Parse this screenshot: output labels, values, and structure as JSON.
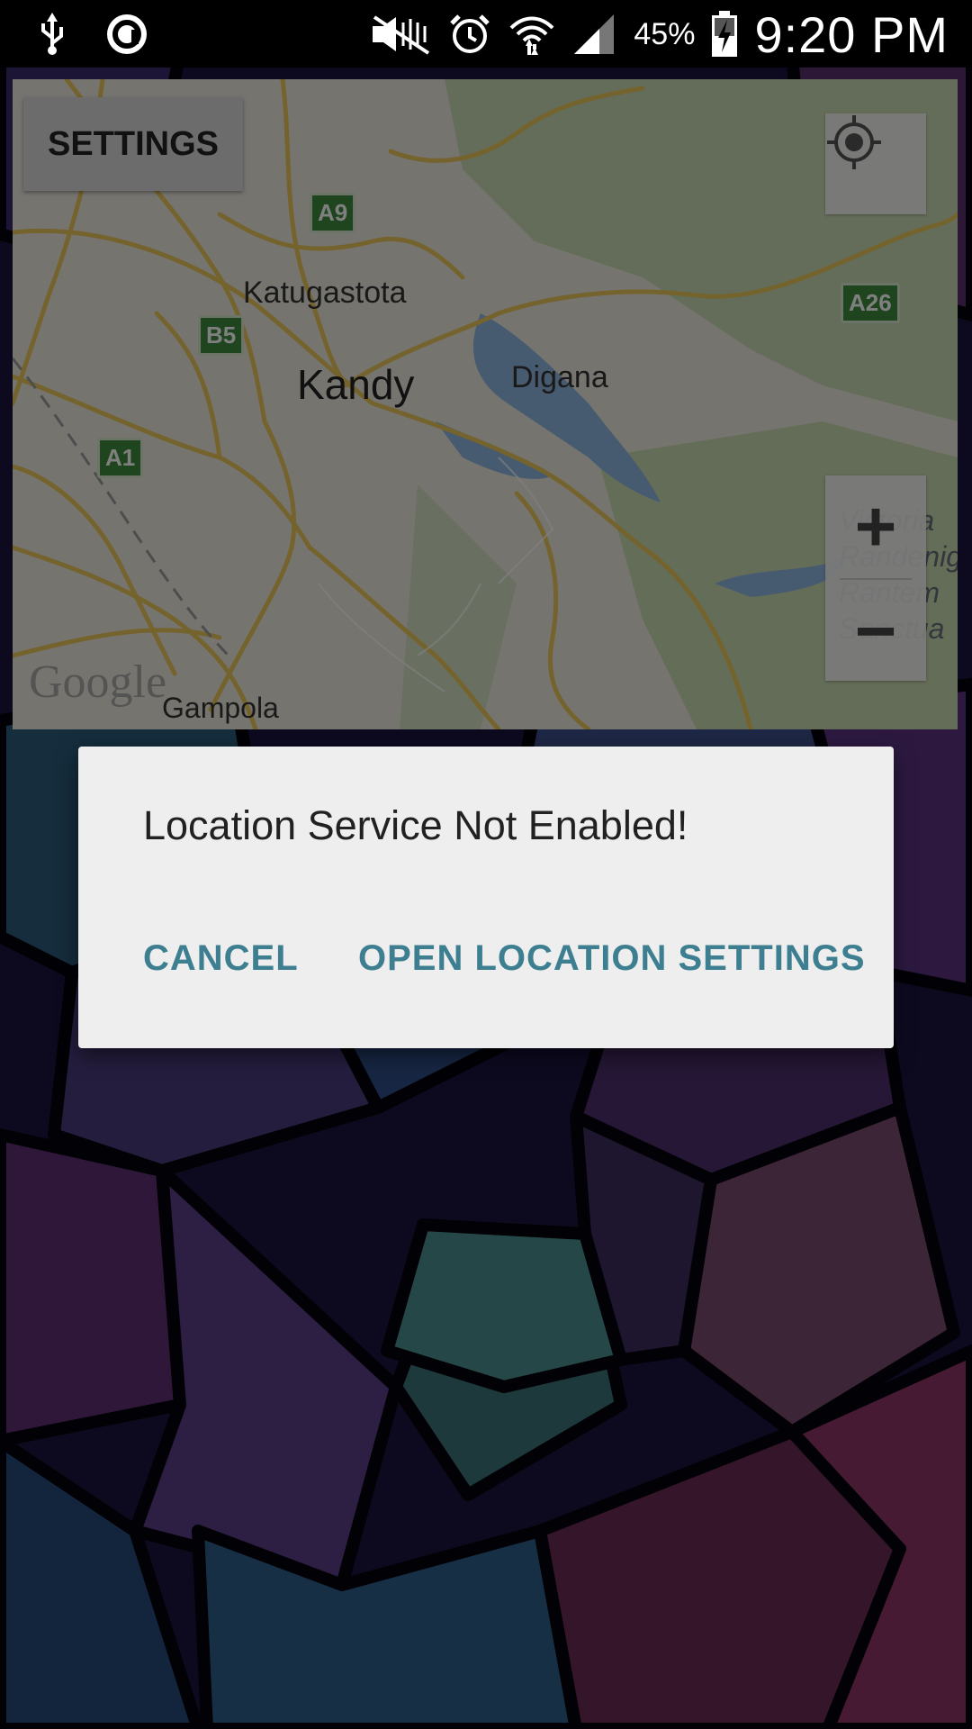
{
  "status_bar": {
    "battery_percent": "45%",
    "time": "9:20 PM",
    "icons": [
      "usb-icon",
      "app-notification-icon",
      "mute-icon",
      "alarm-icon",
      "wifi-icon",
      "signal-icon",
      "battery-charging-icon"
    ]
  },
  "map": {
    "settings_button_label": "SETTINGS",
    "places": {
      "katugastota": "Katugastota",
      "kandy": "Kandy",
      "digana": "Digana",
      "gampola": "Gampola",
      "victoria_partial": "Victoria\nRandenig\nRantem\nSanctua"
    },
    "road_shields": {
      "a9": "A9",
      "b5": "B5",
      "a1": "A1",
      "a26": "A26"
    },
    "logo": "Google",
    "zoom_in_label": "+",
    "zoom_out_label": "−"
  },
  "dialog": {
    "message": "Location Service Not Enabled!",
    "cancel_label": "CANCEL",
    "confirm_label": "OPEN LOCATION SETTINGS",
    "accent_color": "#3d7f91"
  }
}
